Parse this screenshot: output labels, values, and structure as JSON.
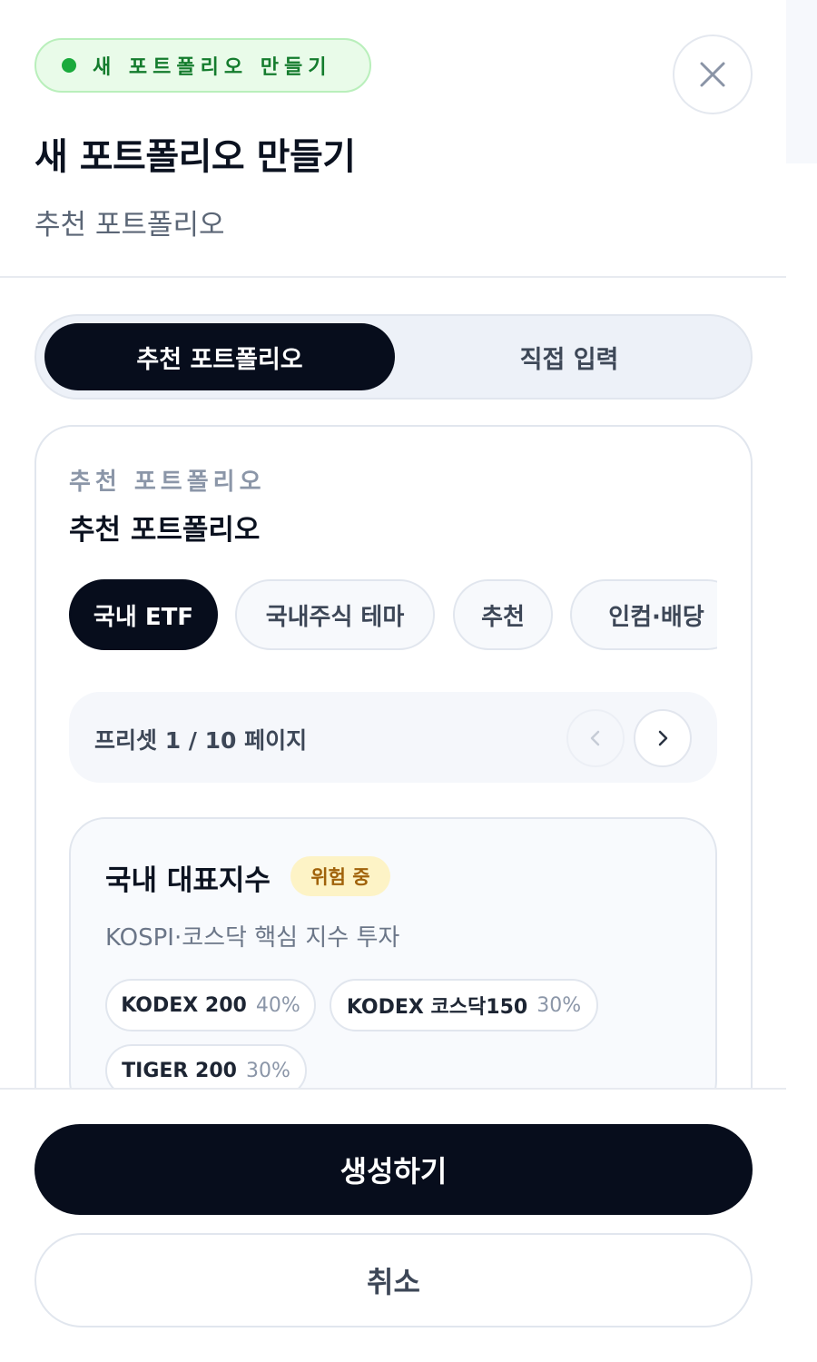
{
  "header": {
    "badge": "새 포트폴리오 만들기",
    "title": "새 포트폴리오 만들기",
    "subtitle": "추천 포트폴리오"
  },
  "mode_tabs": [
    {
      "label": "추천 포트폴리오",
      "active": true
    },
    {
      "label": "직접 입력",
      "active": false
    }
  ],
  "card": {
    "eyebrow": "추천 포트폴리오",
    "title": "추천 포트폴리오",
    "categories": [
      {
        "label": "국내 ETF",
        "active": true
      },
      {
        "label": "국내주식 테마",
        "active": false
      },
      {
        "label": "추천",
        "active": false
      },
      {
        "label": "인컴·배당",
        "active": false
      }
    ],
    "pager": {
      "label": "프리셋 1 / 10 페이지"
    },
    "preset": {
      "name": "국내 대표지수",
      "risk": "위험 중",
      "description": "KOSPI·코스닥 핵심 지수 투자",
      "holdings": [
        {
          "name": "KODEX 200",
          "weight": "40%"
        },
        {
          "name": "KODEX 코스닥150",
          "weight": "30%"
        },
        {
          "name": "TIGER 200",
          "weight": "30%"
        }
      ]
    }
  },
  "footer": {
    "create_label": "생성하기",
    "cancel_label": "취소"
  },
  "colors": {
    "primary": "#070d1c",
    "badge_green": "#1aaa3c",
    "risk_bg": "#fdf3c6",
    "risk_text": "#a0620a"
  },
  "icons": {
    "close": "close-icon",
    "prev": "chevron-left-icon",
    "next": "chevron-right-icon"
  }
}
